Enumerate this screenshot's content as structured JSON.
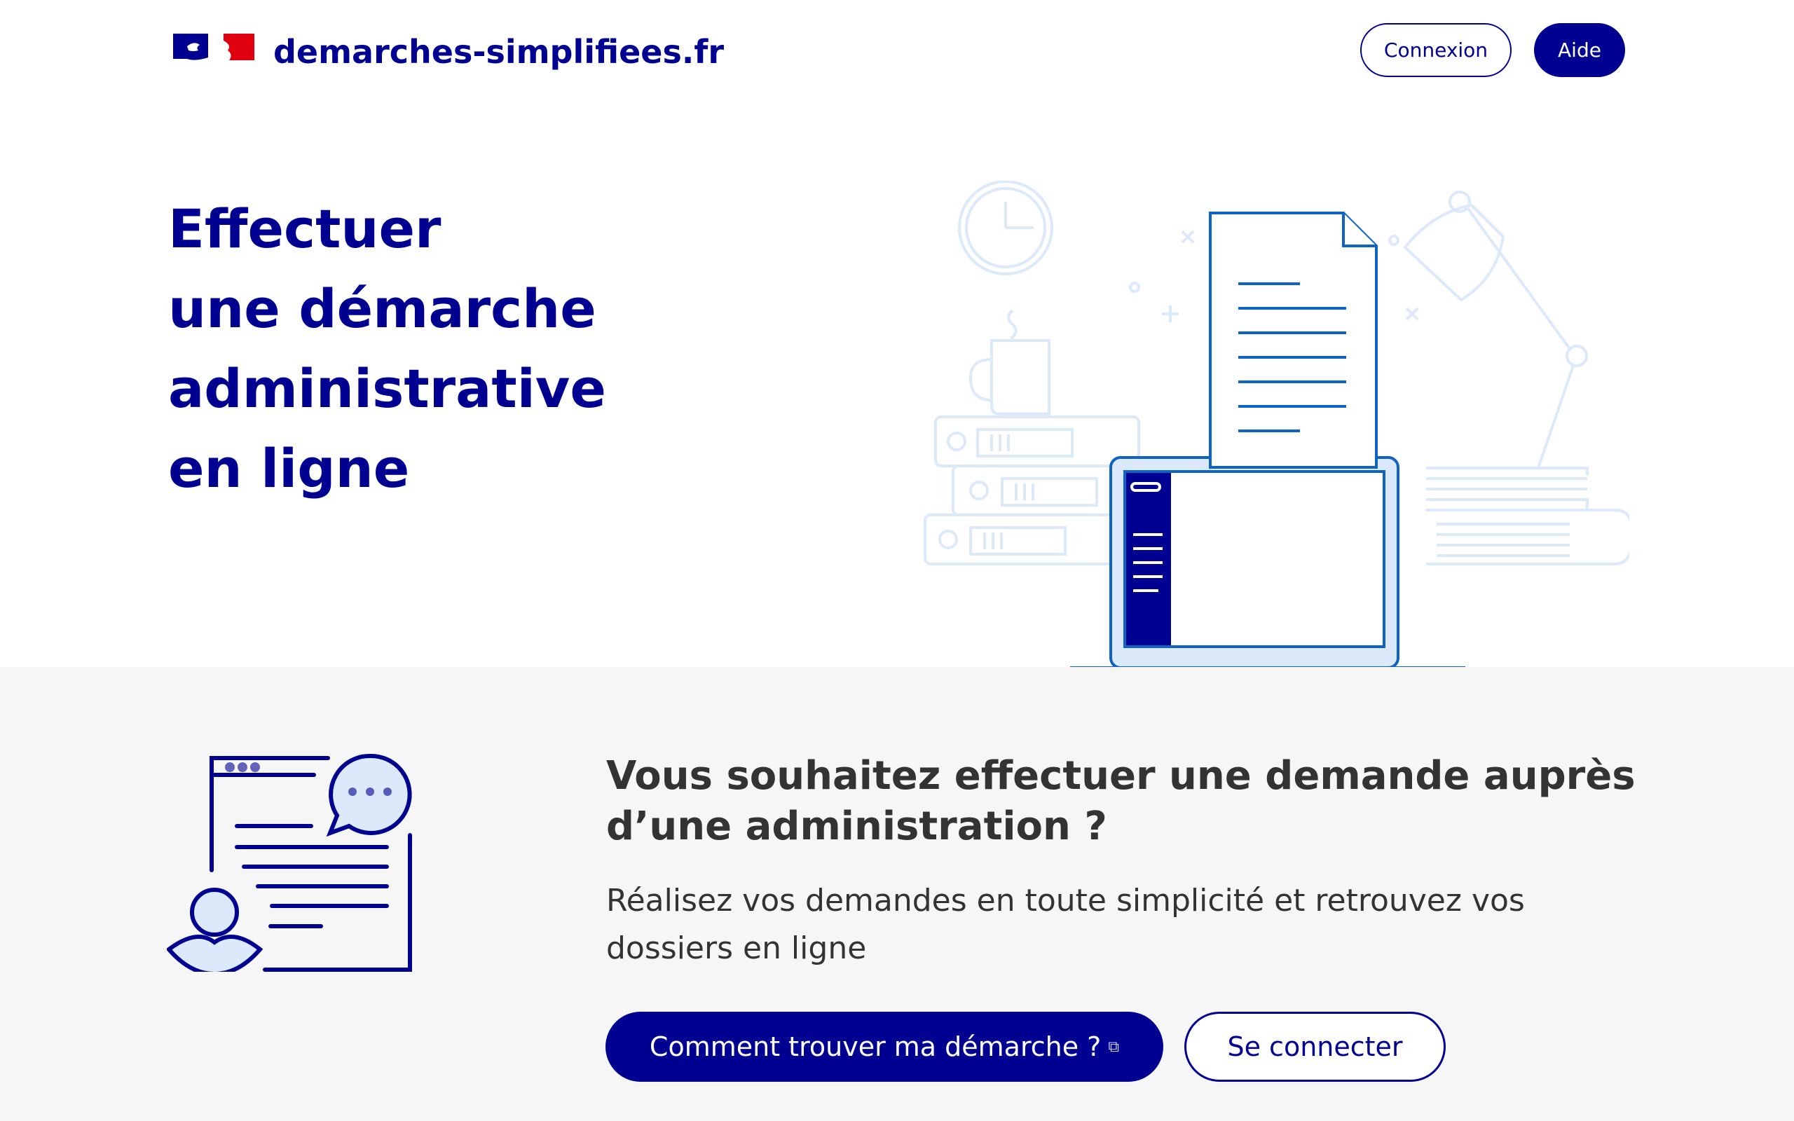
{
  "header": {
    "site_name": "demarches-simplifiees.fr",
    "connexion_label": "Connexion",
    "aide_label": "Aide"
  },
  "hero": {
    "title_lines": [
      "Effectuer",
      "une démarche",
      "administrative",
      "en ligne"
    ]
  },
  "lower": {
    "title": "Vous souhaitez effectuer une demande auprès d’une administration ?",
    "description": "Réalisez vos demandes en toute simplicité et retrouvez vos dossiers en ligne",
    "primary_button_label": "Comment trouver ma démarche ?",
    "secondary_button_label": "Se connecter"
  },
  "icons": {
    "logo": "marianne-logo-icon",
    "hero": "laptop-documents-illustration",
    "lower": "form-chat-user-icon",
    "external": "external-link-icon"
  },
  "colors": {
    "brand_blue": "#000091",
    "illustration_blue": "#0f63c4",
    "light_blue": "#dbe9fb",
    "section_bg": "#f6f6f6",
    "text_dark": "#333333",
    "marianne_red": "#e1000f"
  }
}
